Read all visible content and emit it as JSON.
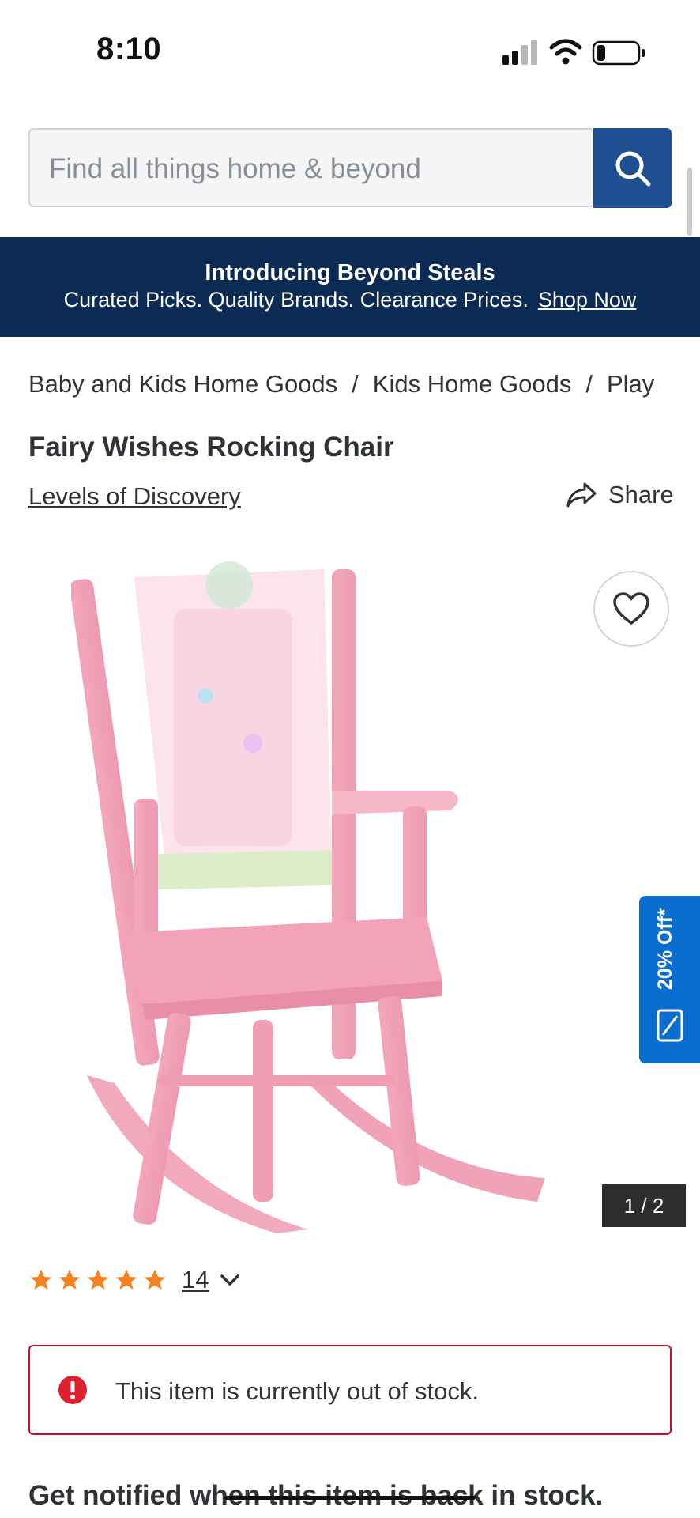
{
  "status_bar": {
    "time": "8:10"
  },
  "search": {
    "placeholder": "Find all things home & beyond",
    "button_icon": "search-icon"
  },
  "banner": {
    "title": "Introducing Beyond Steals",
    "subtitle": "Curated Picks. Quality Brands. Clearance Prices.",
    "link": "Shop Now",
    "background": "#0c2b54"
  },
  "breadcrumb": {
    "items": [
      "Baby and Kids Home Goods",
      "Kids Home Goods",
      "Play"
    ],
    "separator": "/"
  },
  "product": {
    "title": "Fairy Wishes Rocking Chair",
    "brand": "Levels of Discovery",
    "share_label": "Share",
    "image_counter": "1 / 2",
    "image_icon": "pink-rocking-chair-image",
    "promo_tab": "20% Off*",
    "rating": {
      "stars": 5,
      "max_stars": 5,
      "count": "14",
      "star_color": "#f58220"
    },
    "stock_message": "This item is currently out of stock.",
    "notify_text": "Get notified when this item is back in stock."
  },
  "colors": {
    "accent": "#1d4f91",
    "promo": "#0a6ed1",
    "error": "#c8102e"
  }
}
